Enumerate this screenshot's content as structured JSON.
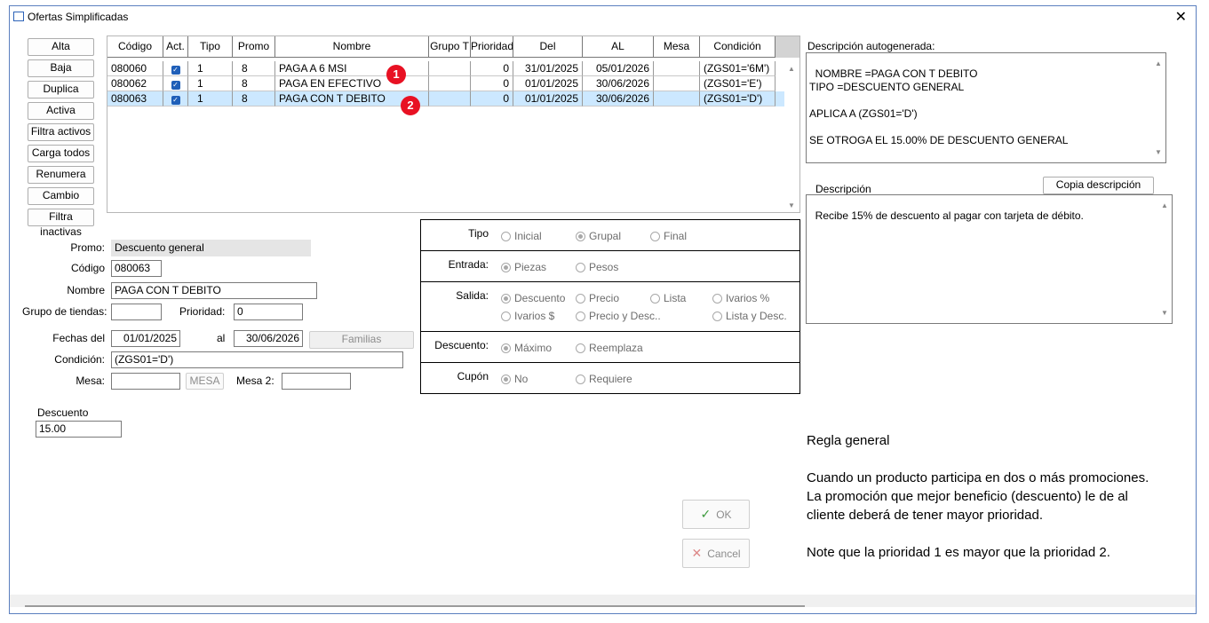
{
  "window": {
    "title": "Ofertas Simplificadas",
    "close": "✕"
  },
  "sidebar": {
    "buttons": [
      "Alta",
      "Baja",
      "Duplica",
      "Activa",
      "Filtra activos",
      "Carga todos",
      "Renumera",
      "Cambio",
      "Filtra inactivas"
    ]
  },
  "grid": {
    "headers": [
      "Código",
      "Act.",
      "Tipo",
      "Promo",
      "Nombre",
      "Grupo T",
      "Prioridad",
      "Del",
      "AL",
      "Mesa",
      "Condición"
    ],
    "rows": [
      {
        "codigo": "080060",
        "act": "✓",
        "tipo": "1",
        "promo": "8",
        "nombre": "PAGA A 6 MSI",
        "grupo": "",
        "prioridad": "0",
        "del": "31/01/2025",
        "al": "05/01/2026",
        "mesa": "",
        "condicion": "(ZGS01='6M')"
      },
      {
        "codigo": "080062",
        "act": "✓",
        "tipo": "1",
        "promo": "8",
        "nombre": "PAGA EN EFECTIVO",
        "grupo": "",
        "prioridad": "0",
        "del": "01/01/2025",
        "al": "30/06/2026",
        "mesa": "",
        "condicion": "(ZGS01='E')"
      },
      {
        "codigo": "080063",
        "act": "✓",
        "tipo": "1",
        "promo": "8",
        "nombre": "PAGA CON T DEBITO",
        "grupo": "",
        "prioridad": "0",
        "del": "01/01/2025",
        "al": "30/06/2026",
        "mesa": "",
        "condicion": "(ZGS01='D')"
      }
    ],
    "badges": [
      "1",
      "2"
    ]
  },
  "form": {
    "promo_label": "Promo:",
    "promo_value": "Descuento general",
    "codigo_label": "Código",
    "codigo_value": "080063",
    "nombre_label": "Nombre",
    "nombre_value": "PAGA CON T DEBITO",
    "grupo_label": "Grupo de tiendas:",
    "grupo_value": "",
    "prioridad_label": "Prioridad:",
    "prioridad_value": "0",
    "fechas_label": "Fechas del",
    "fecha_del": "01/01/2025",
    "al_label": "al",
    "fecha_al": "30/06/2026",
    "familias": "Familias",
    "condicion_label": "Condición:",
    "condicion_value": "(ZGS01='D')",
    "mesa_label": "Mesa:",
    "mesa_value": "",
    "mesa_button": "MESA",
    "mesa2_label": "Mesa 2:",
    "mesa2_value": "",
    "descuento_label": "Descuento",
    "descuento_value": "15.00"
  },
  "options": {
    "tipo": {
      "label": "Tipo",
      "items": [
        "Inicial",
        "Grupal",
        "Final"
      ],
      "selected": "Grupal"
    },
    "entrada": {
      "label": "Entrada:",
      "items": [
        "Piezas",
        "Pesos"
      ],
      "selected": "Piezas"
    },
    "salida": {
      "label": "Salida:",
      "items": [
        "Descuento",
        "Precio",
        "Lista",
        "Ivarios %",
        "Ivarios $",
        "Precio y Desc..",
        "Lista y Desc."
      ],
      "selected": "Descuento"
    },
    "descuento": {
      "label": "Descuento:",
      "items": [
        "Máximo",
        "Reemplaza"
      ],
      "selected": "Máximo"
    },
    "cupon": {
      "label": "Cupón",
      "items": [
        "No",
        "Requiere"
      ],
      "selected": "No"
    }
  },
  "right": {
    "auto_label": "Descripción autogenerada:",
    "auto_text": "NOMBRE =PAGA CON T DEBITO\nTIPO =DESCUENTO GENERAL\n\nAPLICA A (ZGS01='D')\n\nSE OTROGA EL 15.00% DE DESCUENTO GENERAL",
    "desc_label": "Descripción",
    "copy_button": "Copia descripción",
    "desc_text": "Recibe 15% de descuento al pagar con tarjeta de débito.",
    "rule_text": "Regla general\n\nCuando un producto participa en dos o más  promociones.\nLa promoción que mejor beneficio (descuento)  le de al\ncliente deberá de tener mayor prioridad.\n\nNote que la prioridad 1 es mayor que la prioridad 2."
  },
  "actions": {
    "ok": "OK",
    "cancel": "Cancel",
    "ok_icon": "check-icon",
    "cancel_icon": "x-icon"
  },
  "colors": {
    "selected_row": "#cce8ff",
    "badge": "#e81123",
    "check": "#1f5fb8"
  }
}
